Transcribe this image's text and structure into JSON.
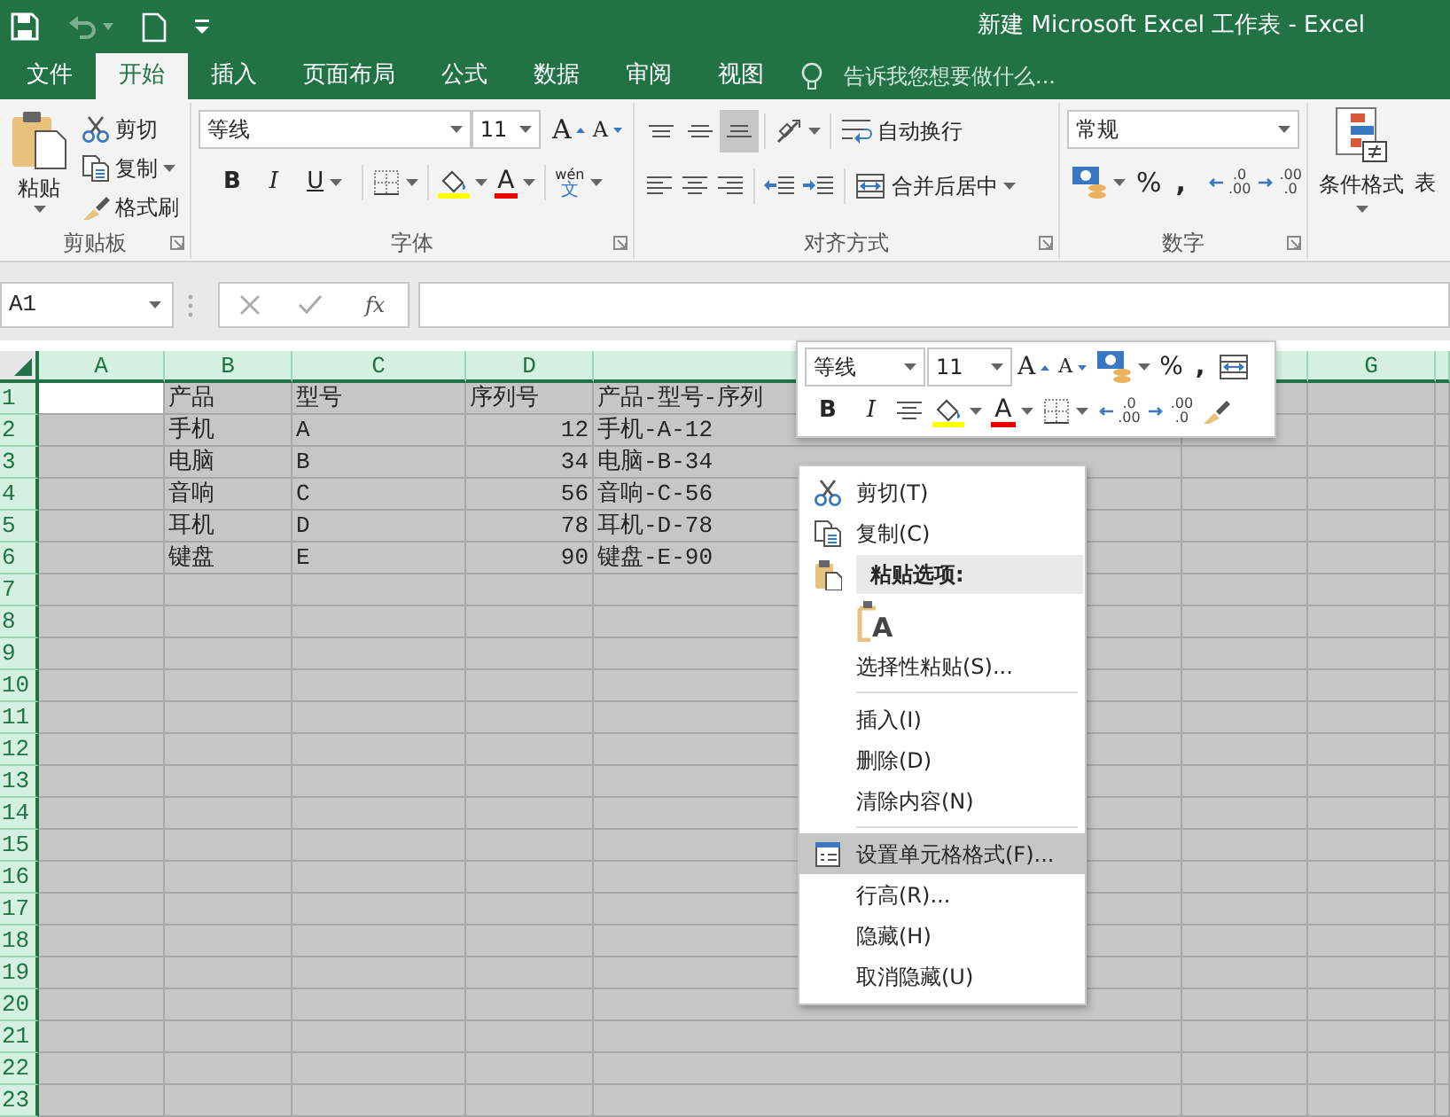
{
  "window": {
    "title": "新建 Microsoft Excel 工作表 - Excel"
  },
  "ribbon_tabs": [
    {
      "label": "文件",
      "selected": false
    },
    {
      "label": "开始",
      "selected": true
    },
    {
      "label": "插入",
      "selected": false
    },
    {
      "label": "页面布局",
      "selected": false
    },
    {
      "label": "公式",
      "selected": false
    },
    {
      "label": "数据",
      "selected": false
    },
    {
      "label": "审阅",
      "selected": false
    },
    {
      "label": "视图",
      "selected": false
    }
  ],
  "tell_me": {
    "placeholder": "告诉我您想要做什么..."
  },
  "clipboard": {
    "label": "剪贴板",
    "paste": "粘贴",
    "cut": "剪切",
    "copy": "复制",
    "format_painter": "格式刷"
  },
  "font": {
    "label": "字体",
    "font_name": "等线",
    "font_size": "11",
    "grow_glyph": "A",
    "shrink_glyph": "A",
    "bold": "B",
    "italic": "I",
    "underline": "U",
    "font_color_glyph": "A",
    "phonetic_top": "wén",
    "phonetic_bottom": "文"
  },
  "alignment": {
    "label": "对齐方式",
    "vertical": [
      {
        "selected": false
      },
      {
        "selected": false
      },
      {
        "selected": true
      }
    ],
    "wrap_text": "自动换行",
    "merge_center": "合并后居中"
  },
  "number": {
    "label": "数字",
    "format": "常规",
    "percent": "%",
    "comma": ",",
    "increase_decimal": [
      ".0",
      ".00"
    ],
    "decrease_decimal": [
      ".00",
      ".0"
    ]
  },
  "styles": {
    "conditional_formatting": "条件格式",
    "format_as_table": "表"
  },
  "formula_bar": {
    "name_box": "A1",
    "fx": "fx"
  },
  "sheet": {
    "columns": [
      "A",
      "B",
      "C",
      "D",
      "G"
    ],
    "rows": [
      {
        "header": "1",
        "active": true,
        "cells": [
          {
            "text": "产品",
            "kind": "text"
          },
          {
            "text": "型号",
            "kind": "text"
          },
          {
            "text": "序列号",
            "kind": "text"
          },
          {
            "text": "产品-型号-序列",
            "kind": "text"
          }
        ]
      },
      {
        "header": "2",
        "active": false,
        "cells": [
          {
            "text": "手机",
            "kind": "text"
          },
          {
            "text": "A",
            "kind": "text"
          },
          {
            "text": "12",
            "kind": "number"
          },
          {
            "text": "手机-A-12",
            "kind": "text"
          }
        ]
      },
      {
        "header": "3",
        "active": false,
        "cells": [
          {
            "text": "电脑",
            "kind": "text"
          },
          {
            "text": "B",
            "kind": "text"
          },
          {
            "text": "34",
            "kind": "number"
          },
          {
            "text": "电脑-B-34",
            "kind": "text"
          }
        ]
      },
      {
        "header": "4",
        "active": false,
        "cells": [
          {
            "text": "音响",
            "kind": "text"
          },
          {
            "text": "C",
            "kind": "text"
          },
          {
            "text": "56",
            "kind": "number"
          },
          {
            "text": "音响-C-56",
            "kind": "text"
          }
        ]
      },
      {
        "header": "5",
        "active": false,
        "cells": [
          {
            "text": "耳机",
            "kind": "text"
          },
          {
            "text": "D",
            "kind": "text"
          },
          {
            "text": "78",
            "kind": "number"
          },
          {
            "text": "耳机-D-78",
            "kind": "text"
          }
        ]
      },
      {
        "header": "6",
        "active": false,
        "cells": [
          {
            "text": "键盘",
            "kind": "text"
          },
          {
            "text": "E",
            "kind": "text"
          },
          {
            "text": "90",
            "kind": "number"
          },
          {
            "text": "键盘-E-90",
            "kind": "text"
          }
        ]
      },
      {
        "header": "7",
        "active": false
      },
      {
        "header": "8",
        "active": false
      },
      {
        "header": "9",
        "active": false
      },
      {
        "header": "10",
        "active": false
      },
      {
        "header": "11",
        "active": false
      },
      {
        "header": "12",
        "active": false
      },
      {
        "header": "13",
        "active": false
      },
      {
        "header": "14",
        "active": false
      },
      {
        "header": "15",
        "active": false
      },
      {
        "header": "16",
        "active": false
      },
      {
        "header": "17",
        "active": false
      },
      {
        "header": "18",
        "active": false
      },
      {
        "header": "19",
        "active": false
      },
      {
        "header": "20",
        "active": false
      },
      {
        "header": "21",
        "active": false
      },
      {
        "header": "22",
        "active": false
      },
      {
        "header": "23",
        "active": false
      }
    ]
  },
  "mini_toolbar": {
    "font_name": "等线",
    "font_size": "11",
    "grow_glyph": "A",
    "shrink_glyph": "A",
    "percent": "%",
    "comma": ",",
    "bold": "B",
    "italic": "I",
    "font_color_glyph": "A",
    "increase_decimal": [
      ".0",
      ".00"
    ],
    "decrease_decimal": [
      ".00",
      ".0"
    ]
  },
  "context_menu": [
    {
      "kind": "cut",
      "label": "剪切(T)",
      "selected": false
    },
    {
      "kind": "copy",
      "label": "复制(C)",
      "selected": false
    },
    {
      "kind": "paste_header",
      "label": "粘贴选项:"
    },
    {
      "kind": "paste_option",
      "glyph": "A",
      "selected": false
    },
    {
      "kind": "command",
      "label": "选择性粘贴(S)...",
      "selected": false
    },
    {
      "kind": "separator"
    },
    {
      "kind": "command",
      "label": "插入(I)",
      "selected": false
    },
    {
      "kind": "command",
      "label": "删除(D)",
      "selected": false
    },
    {
      "kind": "command",
      "label": "清除内容(N)",
      "selected": false
    },
    {
      "kind": "separator"
    },
    {
      "kind": "format_cells",
      "label": "设置单元格格式(F)...",
      "selected": true
    },
    {
      "kind": "command",
      "label": "行高(R)...",
      "selected": false
    },
    {
      "kind": "command",
      "label": "隐藏(H)",
      "selected": false
    },
    {
      "kind": "command",
      "label": "取消隐藏(U)",
      "selected": false
    }
  ]
}
